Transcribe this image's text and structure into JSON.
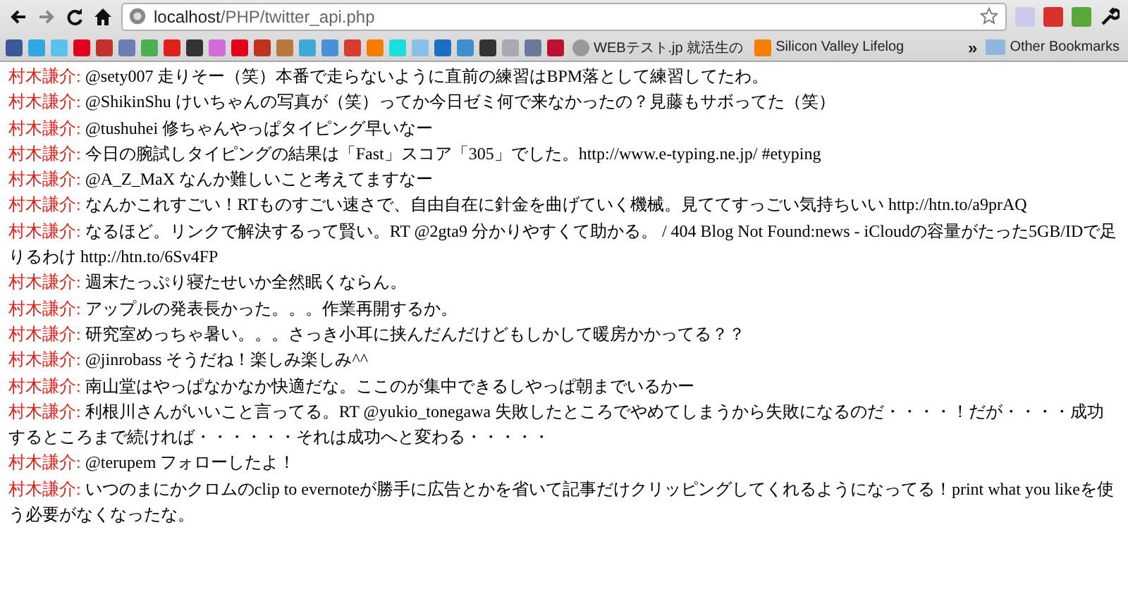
{
  "browser": {
    "url_host": "localhost",
    "url_path": "/PHP/twitter_api.php",
    "bookmarks": [
      {
        "kind": "globe",
        "label": "WEBテスト.jp 就活生の"
      },
      {
        "kind": "blog",
        "label": "Silicon Valley Lifelog"
      }
    ],
    "overflow": "»",
    "other_bookmarks": "Other Bookmarks"
  },
  "tweets": [
    {
      "author": "村木謙介:",
      "text": "@sety007 走りそー（笑）本番で走らないように直前の練習はBPM落として練習してたわ。"
    },
    {
      "author": "村木謙介:",
      "text": "@ShikinShu けいちゃんの写真が（笑）ってか今日ゼミ何で来なかったの？見藤もサボってた（笑）"
    },
    {
      "author": "村木謙介:",
      "text": "@tushuhei 修ちゃんやっぱタイピング早いなー"
    },
    {
      "author": "村木謙介:",
      "text": "今日の腕試しタイピングの結果は「Fast」スコア「305」でした。http://www.e-typing.ne.jp/ #etyping"
    },
    {
      "author": "村木謙介:",
      "text": "@A_Z_MaX なんか難しいこと考えてますなー"
    },
    {
      "author": "村木謙介:",
      "text": "なんかこれすごい！RTものすごい速さで、自由自在に針金を曲げていく機械。見ててすっごい気持ちいい http://htn.to/a9prAQ"
    },
    {
      "author": "村木謙介:",
      "text": "なるほど。リンクで解決するって賢い。RT @2gta9 分かりやすくて助かる。 / 404 Blog Not Found:news - iCloudの容量がたった5GB/IDで足りるわけ http://htn.to/6Sv4FP"
    },
    {
      "author": "村木謙介:",
      "text": "週末たっぷり寝たせいか全然眠くならん。"
    },
    {
      "author": "村木謙介:",
      "text": "アップルの発表長かった。。。作業再開するか。"
    },
    {
      "author": "村木謙介:",
      "text": "研究室めっちゃ暑い。。。さっき小耳に挟んだんだけどもしかして暖房かかってる？？"
    },
    {
      "author": "村木謙介:",
      "text": "@jinrobass そうだね！楽しみ楽しみ^^"
    },
    {
      "author": "村木謙介:",
      "text": "南山堂はやっぱなかなか快適だな。ここのが集中できるしやっぱ朝までいるかー"
    },
    {
      "author": "村木謙介:",
      "text": "利根川さんがいいこと言ってる。RT @yukio_tonegawa 失敗したところでやめてしまうから失敗になるのだ・・・・！だが・・・・成功するところまで続ければ・・・・・・それは成功へと変わる・・・・・"
    },
    {
      "author": "村木謙介:",
      "text": "@terupem フォローしたよ！"
    },
    {
      "author": "村木謙介:",
      "text": "いつのまにかクロムのclip to evernoteが勝手に広告とかを省いて記事だけクリッピングしてくれるようになってる！print what you likeを使う必要がなくなったな。"
    }
  ]
}
